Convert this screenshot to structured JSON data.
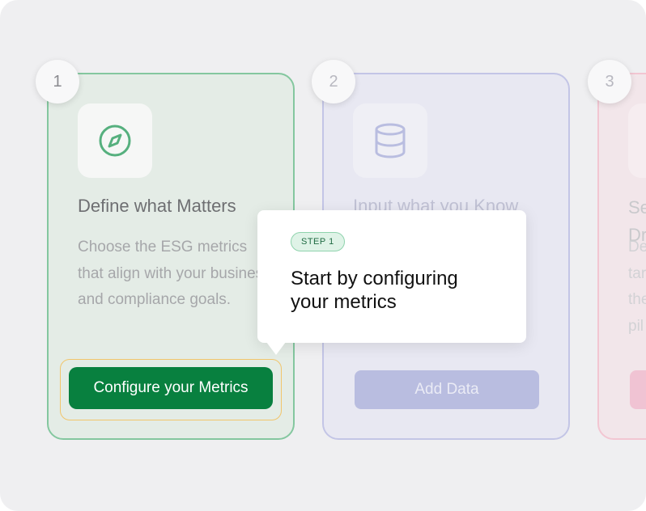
{
  "steps": [
    {
      "number": "1",
      "icon": "compass-icon",
      "title": "Define what Matters",
      "description": "Choose the ESG metrics that align with your business and compliance goals.",
      "button_label": "Configure your Metrics"
    },
    {
      "number": "2",
      "icon": "database-icon",
      "title": "Input what you Know",
      "button_label": "Add Data"
    },
    {
      "number": "3",
      "title_line1": "Se",
      "title_line2": "Dr",
      "description_lines": [
        "De",
        "tar",
        "the",
        "pil"
      ]
    }
  ],
  "tooltip": {
    "badge": "STEP 1",
    "text": "Start by configuring your metrics"
  },
  "colors": {
    "primary_green": "#08803f",
    "card1_border": "#84c79f",
    "card2_border": "#c3c5e6",
    "card3_border": "#f2c6d2",
    "focus_ring": "#f1c56b"
  }
}
